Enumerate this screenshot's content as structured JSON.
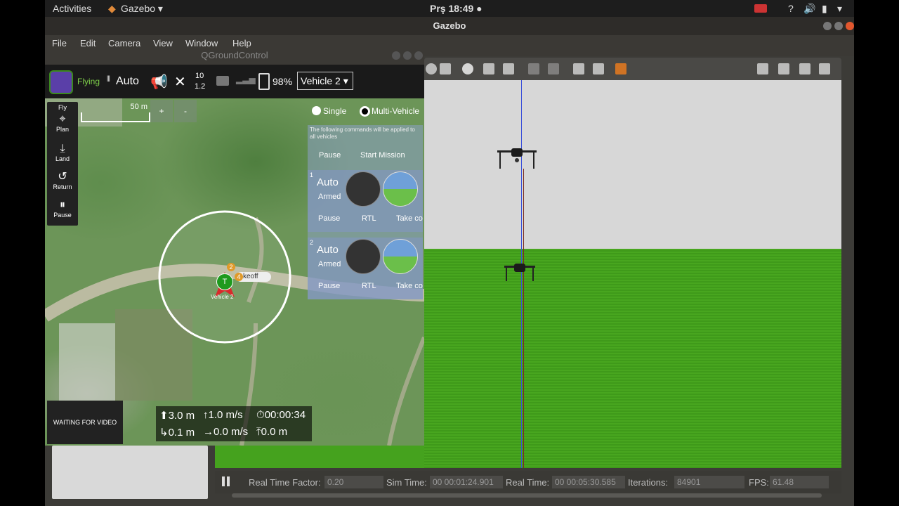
{
  "topbar": {
    "activities": "Activities",
    "app_menu": "Gazebo ▾",
    "clock": "Prş 18:49 ●",
    "help": "?"
  },
  "gazebo": {
    "window_title": "Gazebo",
    "menu": [
      "File",
      "Edit",
      "Camera",
      "View",
      "Window",
      "Help"
    ],
    "status": {
      "rtf_label": "Real Time Factor:",
      "rtf_value": "0.20",
      "sim_label": "Sim Time:",
      "sim_value": "00 00:01:24.901",
      "real_label": "Real Time:",
      "real_value": "00 00:05:30.585",
      "iter_label": "Iterations:",
      "iter_value": "84901",
      "fps_label": "FPS:",
      "fps_value": "61.48"
    }
  },
  "qgc": {
    "window_title": "QGroundControl",
    "flight_state": "Flying",
    "flight_mode": "Auto",
    "sat_count": "10",
    "hdop": "1.2",
    "battery": "98%",
    "vehicle_select": "Vehicle 2 ▾",
    "scale_label": "50 m",
    "zoom_in": "+",
    "zoom_out": "-",
    "tools": [
      "Fly",
      "Plan",
      "Land",
      "Return",
      "Pause"
    ],
    "radio_single": "Single",
    "radio_multi": "Multi-Vehicle",
    "multi_note": "The following commands will be applied to all vehicles",
    "global_pause": "Pause",
    "start_mission": "Start Mission",
    "vehicles": [
      {
        "index": "1",
        "mode": "Auto",
        "armed": "Armed",
        "pause": "Pause",
        "rtl": "RTL",
        "take": "Take co"
      },
      {
        "index": "2",
        "mode": "Auto",
        "armed": "Armed",
        "pause": "Pause",
        "rtl": "RTL",
        "take": "Take co"
      }
    ],
    "map_marker": "T",
    "badge_2": "2",
    "badge_4": "4",
    "takeoff_label": "keoff",
    "vehicle_label": "Vehicle 2",
    "video_text": "WAITING FOR VIDEO",
    "telemetry": {
      "altitude": "⬆3.0 m",
      "climb": "↑1.0 m/s",
      "flight_time": "⏱00:00:34",
      "distance": "↳0.1 m",
      "ground_speed": "→0.0 m/s",
      "home_distance": "⤒0.0 m"
    }
  }
}
